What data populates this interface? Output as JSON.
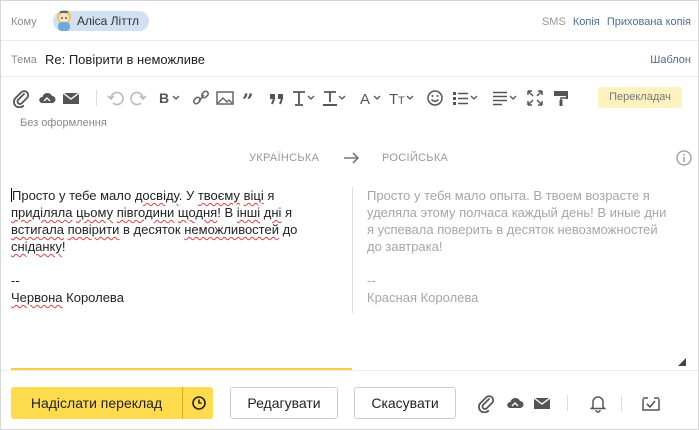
{
  "to": {
    "label": "Кому",
    "recipient": "Аліса Літтл",
    "links": {
      "sms": "SMS",
      "cc": "Копія",
      "bcc": "Прихована копія"
    }
  },
  "subject": {
    "label": "Тема",
    "value": "Re: Повірити в неможливе",
    "template": "Шаблон"
  },
  "toolbar": {
    "icons": [
      "paperclip-icon",
      "cloud-attach-icon",
      "mail-attach-icon",
      "undo-icon",
      "redo-icon",
      "bold-icon",
      "link-icon",
      "image-icon",
      "quote-icon",
      "text-style-icon",
      "text-color-icon",
      "font-icon",
      "font-size-icon",
      "emoji-icon",
      "list-icon",
      "align-icon",
      "fullscreen-icon",
      "format-brush-icon"
    ],
    "translator": "Перекладач",
    "no_format": "Без оформлення"
  },
  "translate": {
    "source_lang": "УКРАЇНСЬКА",
    "target_lang": "РОСІЙСЬКА"
  },
  "source": {
    "lines": [
      "Просто у тебе мало досвіду. У твоєму віці я",
      "приділяла цьому півгодини щодня! В інші дні я",
      "встигала повірити в десяток неможливостей до",
      "сніданку!"
    ],
    "sig_dash": "--",
    "signature": "Червона Королева"
  },
  "target": {
    "lines": [
      "Просто у тебя мало опыта. В твоем возрасте я",
      "уделяла этому полчаса каждый день! В иные дни",
      "я успевала поверить в десяток невозможностей",
      "до завтрака!"
    ],
    "sig_dash": "--",
    "signature": "Красная Королева"
  },
  "actions": {
    "send_translation": "Надіслати переклад",
    "edit": "Редагувати",
    "cancel": "Скасувати",
    "icons": [
      "paperclip-icon",
      "cloud-attach-icon",
      "mail-attach-icon",
      "bell-icon",
      "done-check-icon"
    ]
  },
  "colors": {
    "accent": "#ffdb4d",
    "link": "#4a6e94",
    "chip": "#d1e0f3",
    "translator_bg": "#fcf2c0"
  }
}
